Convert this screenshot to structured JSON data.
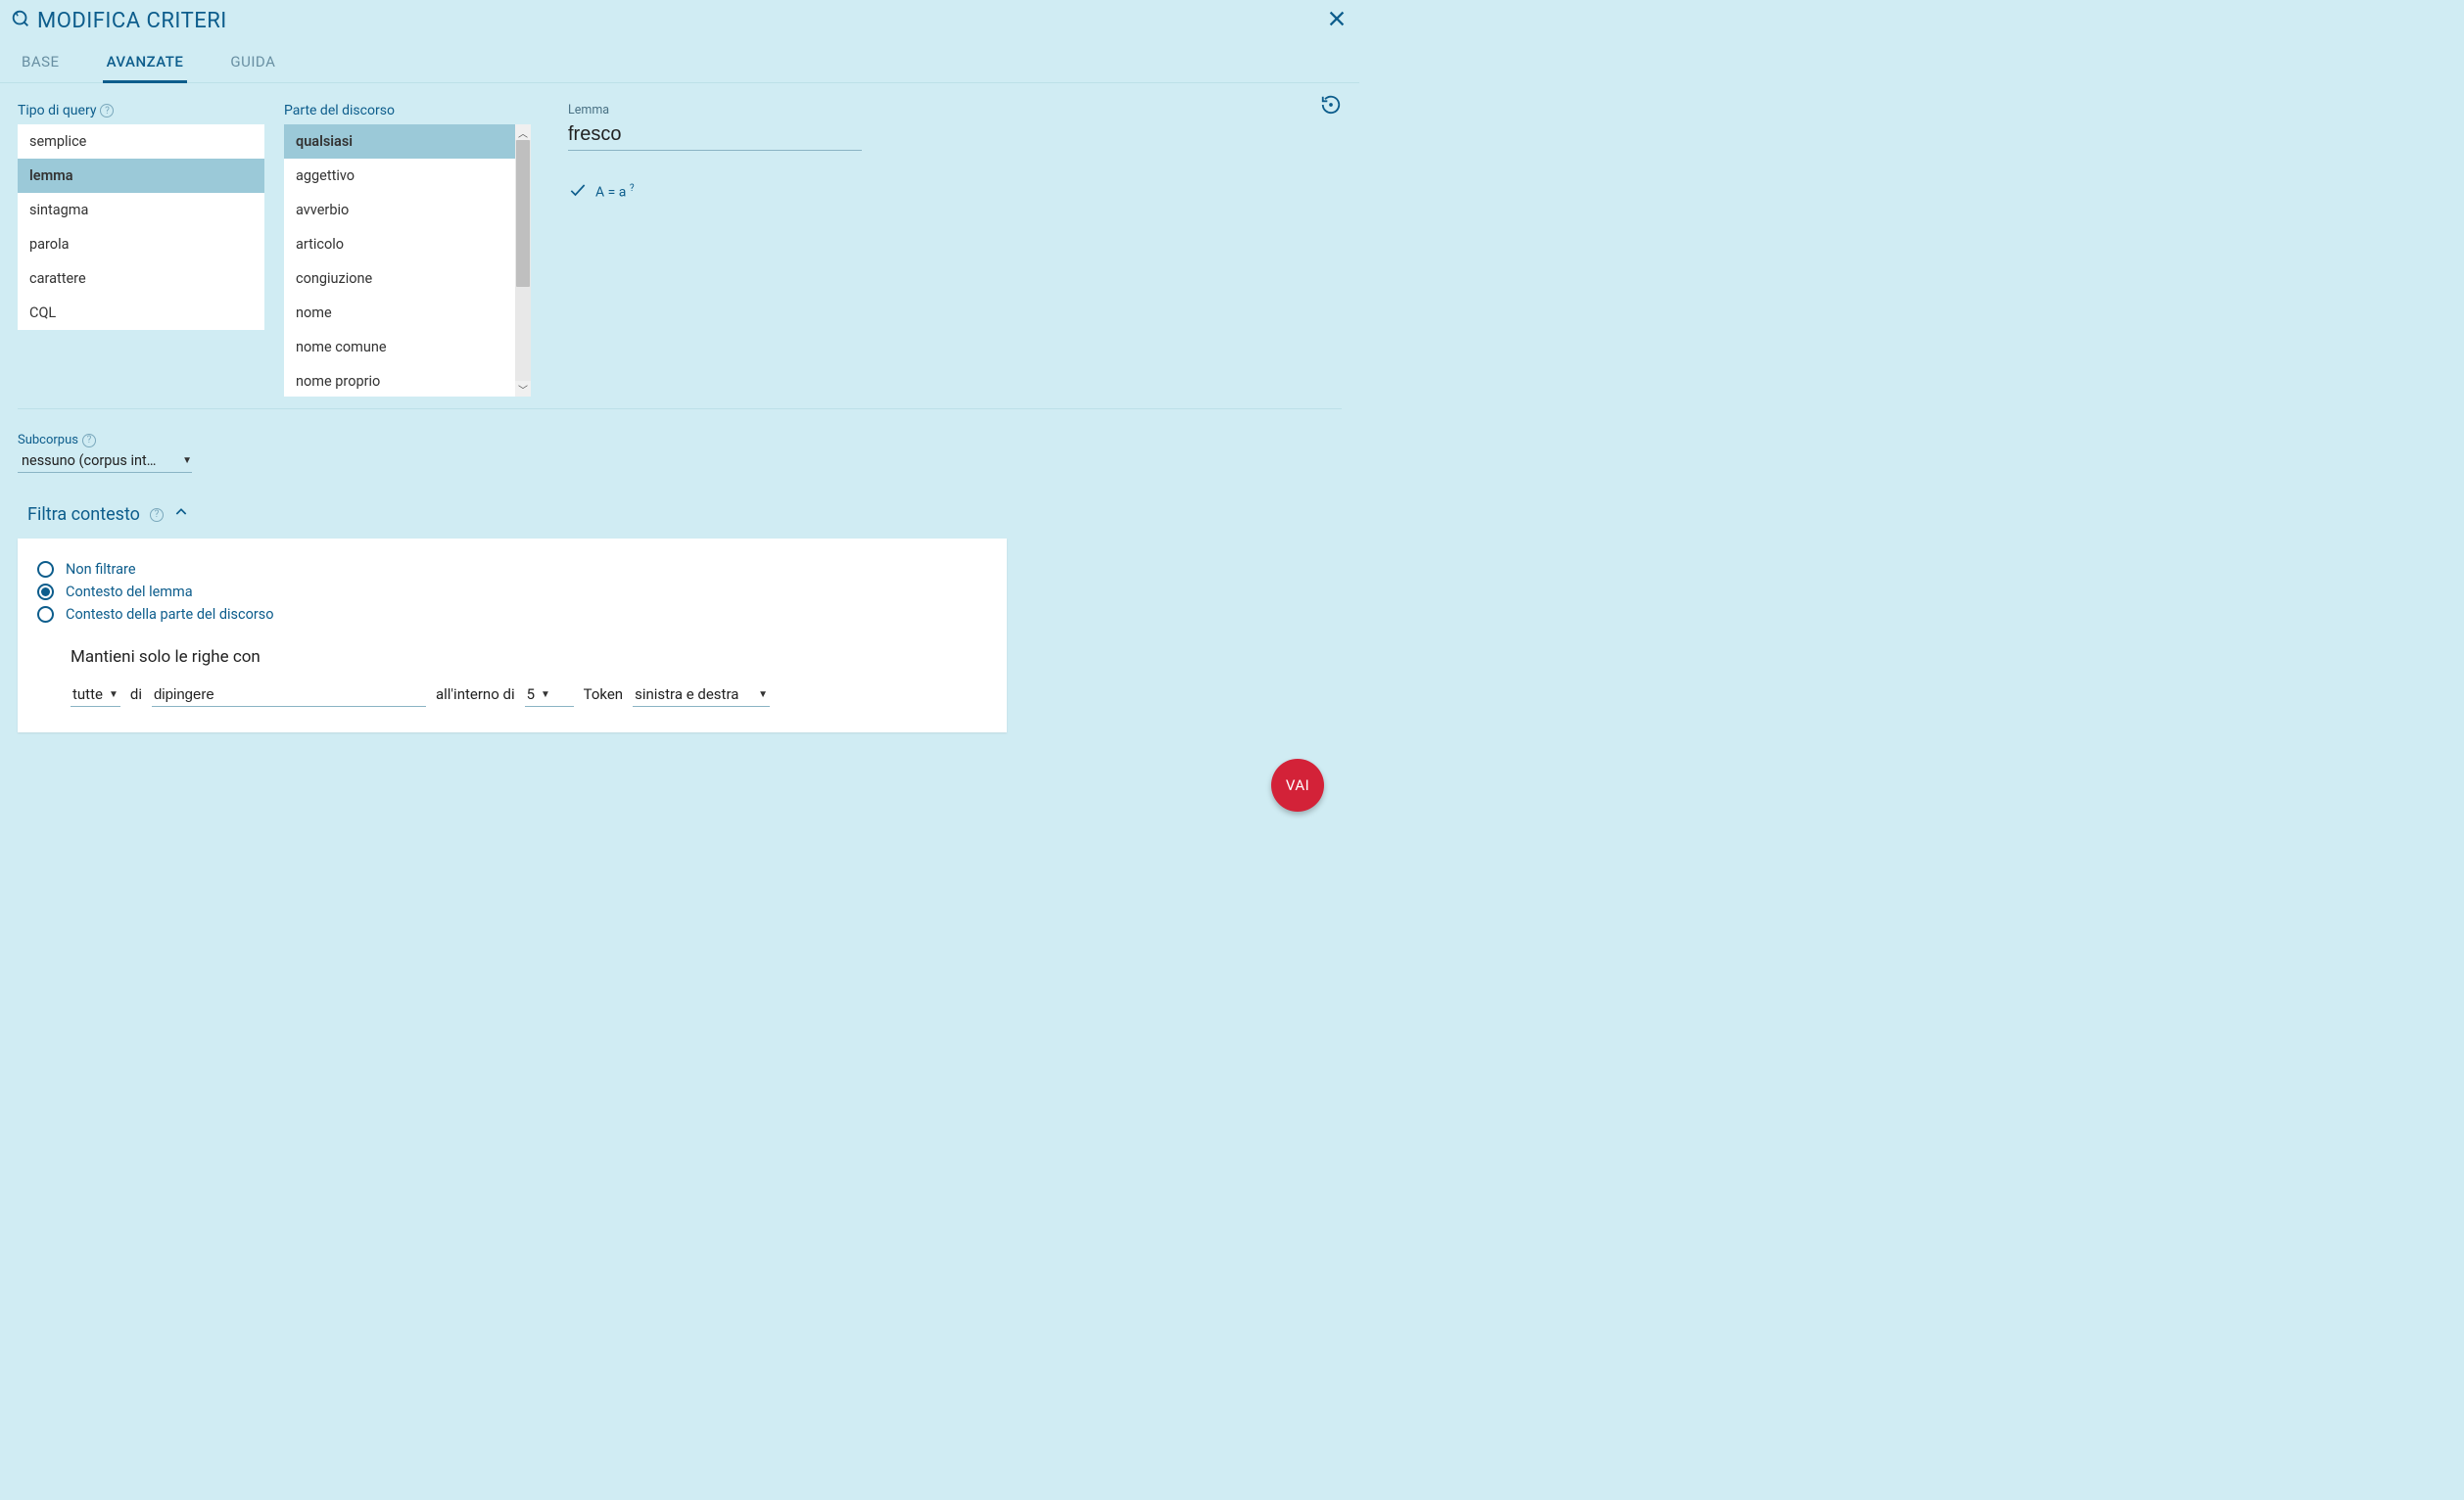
{
  "header": {
    "title": "MODIFICA CRITERI"
  },
  "tabs": {
    "base": "BASE",
    "avanzate": "AVANZATE",
    "guida": "GUIDA"
  },
  "query_type": {
    "label": "Tipo di query",
    "items": [
      "semplice",
      "lemma",
      "sintagma",
      "parola",
      "carattere",
      "CQL"
    ],
    "selected": "lemma"
  },
  "pos": {
    "label": "Parte del discorso",
    "items": [
      "qualsiasi",
      "aggettivo",
      "avverbio",
      "articolo",
      "congiuzione",
      "nome",
      "nome comune",
      "nome proprio"
    ],
    "selected": "qualsiasi"
  },
  "lemma": {
    "label": "Lemma",
    "value": "fresco",
    "case_label": "A = a",
    "case_sup": "?"
  },
  "subcorpus": {
    "label": "Subcorpus",
    "value": "nessuno (corpus int…"
  },
  "filter": {
    "header": "Filtra contesto",
    "options": {
      "none": "Non filtrare",
      "lemma": "Contesto del lemma",
      "pos": "Contesto della parte del discorso"
    },
    "keep_text": "Mantieni solo le righe con",
    "row": {
      "all": "tutte",
      "of": "di",
      "input_value": "dipingere",
      "within": "all'interno di",
      "count": "5",
      "token": "Token",
      "direction": "sinistra e destra"
    }
  },
  "fab": "VAI"
}
